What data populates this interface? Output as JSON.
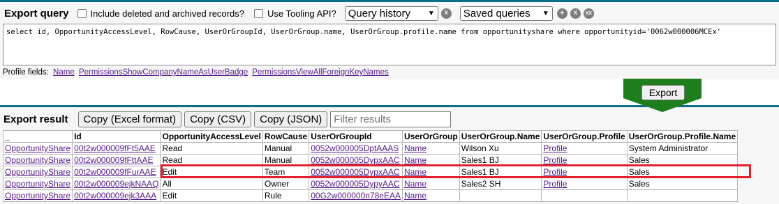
{
  "query_panel": {
    "title": "Export query",
    "include_deleted_label": "Include deleted and archived records?",
    "tooling_api_label": "Use Tooling API?",
    "query_history_label": "Query history",
    "saved_queries_label": "Saved queries",
    "clear_icon_glyph": "X",
    "add_icon_glyph": "+",
    "remove_icon_glyph": "X",
    "remove_all_icon_glyph": "XX",
    "query_text": "select id, OpportunityAccessLevel, RowCause, UserOrGroupId, UserOrGroup.name, UserOrGroup.profile.name from opportunityshare where opportunityid='0062w000006MCEx'",
    "profile_fields_label": "Profile fields:",
    "profile_fields": [
      "Name",
      "PermissionsShowCompanyNameAsUserBadge",
      "PermissionsViewAllForeignKeyNames"
    ]
  },
  "export_button_label": "Export",
  "result_panel": {
    "title": "Export result",
    "copy_excel_label": "Copy (Excel format)",
    "copy_csv_label": "Copy (CSV)",
    "copy_json_label": "Copy (JSON)",
    "filter_placeholder": "Filter results"
  },
  "table": {
    "headers": [
      "_",
      "Id",
      "OpportunityAccessLevel",
      "RowCause",
      "UserOrGroupId",
      "UserOrGroup",
      "UserOrGroup.Name",
      "UserOrGroup.Profile",
      "UserOrGroup.Profile.Name"
    ],
    "rows": [
      [
        "OpportunityShare",
        "00t2w000009fFt5AAE",
        "Read",
        "Manual",
        "0052w000005DptAAAS",
        "Name",
        "Wilson Xu",
        "Profile",
        "System Administrator"
      ],
      [
        "OpportunityShare",
        "00t2w000009fFttAAE",
        "Read",
        "Manual",
        "0052w000005DypxAAC",
        "Name",
        "Sales1 BJ",
        "Profile",
        "Sales"
      ],
      [
        "OpportunityShare",
        "00t2w000009fFurAAE",
        "Edit",
        "Team",
        "0052w000005DypxAAC",
        "Name",
        "Sales1 BJ",
        "Profile",
        "Sales"
      ],
      [
        "OpportunityShare",
        "00t2w000009ejkNAAQ",
        "All",
        "Owner",
        "0052w000005DypyAAC",
        "Name",
        "Sales2 SH",
        "Profile",
        "Sales"
      ],
      [
        "OpportunityShare",
        "00t2w000009ejk3AAA",
        "Edit",
        "Rule",
        "00G2w000000n78eEAA",
        "Name",
        "",
        "",
        ""
      ]
    ],
    "link_columns": [
      0,
      1,
      4,
      5,
      7
    ]
  },
  "colors": {
    "panel_border": "#0b6f86",
    "export_arrow": "#1e7e1e",
    "highlight": "#e0212e",
    "link": "#551a8b"
  }
}
